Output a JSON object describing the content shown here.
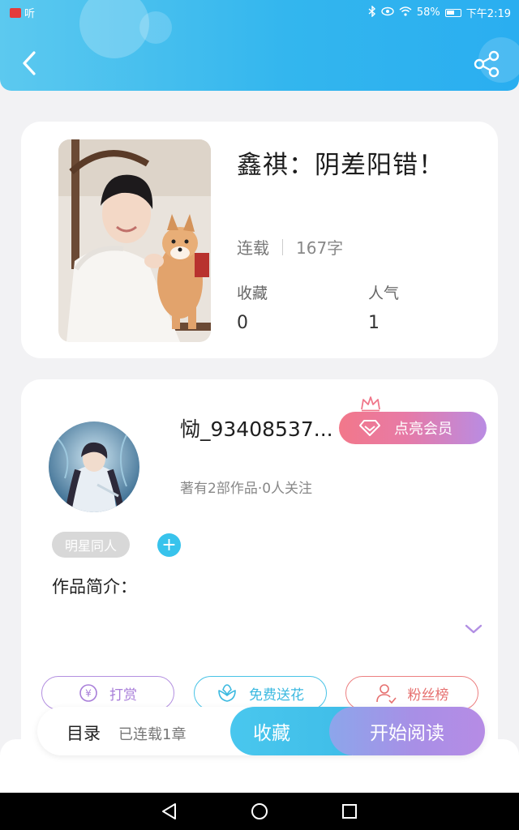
{
  "status_bar": {
    "left_label": "听",
    "battery": "58%",
    "time": "下午2:19"
  },
  "header": {
    "back_icon": "chevron-left-icon",
    "share_icon": "share-icon"
  },
  "book": {
    "title": "鑫祺：阴差阳错！",
    "status": "连载",
    "word_count": "167字",
    "collect_label": "收藏",
    "collect_value": "0",
    "popularity_label": "人气",
    "popularity_value": "1"
  },
  "author": {
    "name": "恸_93408537...",
    "vip_button": "点亮会员",
    "sub_info": "著有2部作品·0人关注",
    "tag": "明星同人",
    "intro_label": "作品简介："
  },
  "actions": {
    "tip_icon_glyph": "¥",
    "tip": "打赏",
    "flower": "免费送花",
    "fans": "粉丝榜"
  },
  "bottom_bar": {
    "toc": "目录",
    "chapter_count": "已连载1章",
    "collect": "收藏",
    "start_reading": "开始阅读"
  },
  "colors": {
    "header_blue": "#33b6ee",
    "accent_cyan": "#38c3ec",
    "vip_pink": "#f2788a",
    "read_purple": "#a88fe6"
  }
}
